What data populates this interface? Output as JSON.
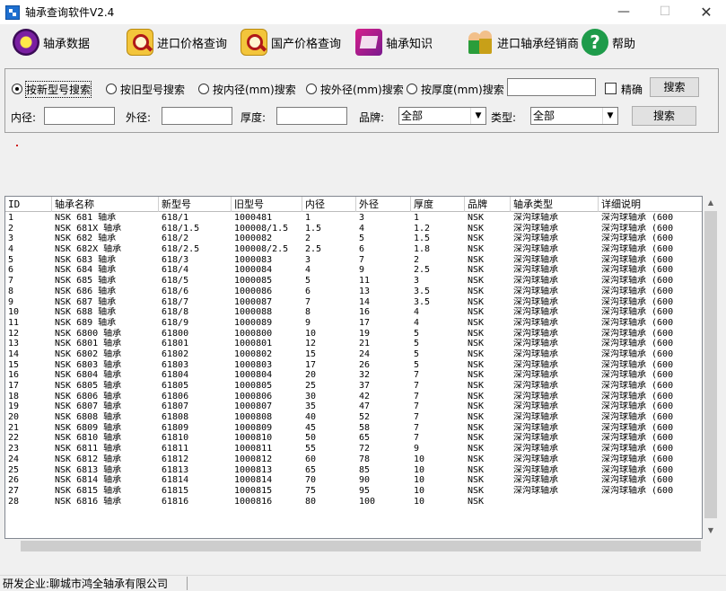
{
  "window": {
    "title": "轴承查询软件V2.4",
    "controls": {
      "minimize": "—",
      "maximize": "☐",
      "close": "✕"
    }
  },
  "toolbar": [
    {
      "label": "轴承数据",
      "icon": "disc-icon"
    },
    {
      "label": "进口价格查询",
      "icon": "magnifier-icon"
    },
    {
      "label": "国产价格查询",
      "icon": "magnifier-icon"
    },
    {
      "label": "轴承知识",
      "icon": "book-icon"
    },
    {
      "label": "进口轴承经销商",
      "icon": "people-icon"
    },
    {
      "label": "帮助",
      "icon": "help-icon"
    }
  ],
  "search": {
    "modes": [
      {
        "label": "按新型号搜索",
        "selected": true
      },
      {
        "label": "按旧型号搜索",
        "selected": false
      },
      {
        "label": "按内径(mm)搜索",
        "selected": false
      },
      {
        "label": "按外径(mm)搜索",
        "selected": false
      },
      {
        "label": "按厚度(mm)搜索",
        "selected": false
      }
    ],
    "keyword_value": "",
    "exact_label": "精确",
    "exact_checked": false,
    "search_button": "搜索",
    "inner_label": "内径:",
    "outer_label": "外径:",
    "thickness_label": "厚度:",
    "brand_label": "品牌:",
    "brand_value": "全部",
    "type_label": "类型:",
    "type_value": "全部",
    "search_button2": "搜索"
  },
  "table": {
    "columns": [
      "ID",
      "轴承名称",
      "新型号",
      "旧型号",
      "内径",
      "外径",
      "厚度",
      "品牌",
      "轴承类型",
      "详细说明"
    ],
    "rows": [
      [
        "1",
        "NSK 681 轴承",
        "618/1",
        "1000481",
        "1",
        "3",
        "1",
        "NSK",
        "深沟球轴承",
        "深沟球轴承 (600"
      ],
      [
        "2",
        "NSK 681X 轴承",
        "618/1.5",
        "100008/1.5",
        "1.5",
        "4",
        "1.2",
        "NSK",
        "深沟球轴承",
        "深沟球轴承 (600"
      ],
      [
        "3",
        "NSK 682 轴承",
        "618/2",
        "1000082",
        "2",
        "5",
        "1.5",
        "NSK",
        "深沟球轴承",
        "深沟球轴承 (600"
      ],
      [
        "4",
        "NSK 682X 轴承",
        "618/2.5",
        "100008/2.5",
        "2.5",
        "6",
        "1.8",
        "NSK",
        "深沟球轴承",
        "深沟球轴承 (600"
      ],
      [
        "5",
        "NSK 683 轴承",
        "618/3",
        "1000083",
        "3",
        "7",
        "2",
        "NSK",
        "深沟球轴承",
        "深沟球轴承 (600"
      ],
      [
        "6",
        "NSK 684 轴承",
        "618/4",
        "1000084",
        "4",
        "9",
        "2.5",
        "NSK",
        "深沟球轴承",
        "深沟球轴承 (600"
      ],
      [
        "7",
        "NSK 685 轴承",
        "618/5",
        "1000085",
        "5",
        "11",
        "3",
        "NSK",
        "深沟球轴承",
        "深沟球轴承 (600"
      ],
      [
        "8",
        "NSK 686 轴承",
        "618/6",
        "1000086",
        "6",
        "13",
        "3.5",
        "NSK",
        "深沟球轴承",
        "深沟球轴承 (600"
      ],
      [
        "9",
        "NSK 687 轴承",
        "618/7",
        "1000087",
        "7",
        "14",
        "3.5",
        "NSK",
        "深沟球轴承",
        "深沟球轴承 (600"
      ],
      [
        "10",
        "NSK 688 轴承",
        "618/8",
        "1000088",
        "8",
        "16",
        "4",
        "NSK",
        "深沟球轴承",
        "深沟球轴承 (600"
      ],
      [
        "11",
        "NSK 689 轴承",
        "618/9",
        "1000089",
        "9",
        "17",
        "4",
        "NSK",
        "深沟球轴承",
        "深沟球轴承 (600"
      ],
      [
        "12",
        "NSK 6800 轴承",
        "61800",
        "1000800",
        "10",
        "19",
        "5",
        "NSK",
        "深沟球轴承",
        "深沟球轴承 (600"
      ],
      [
        "13",
        "NSK 6801 轴承",
        "61801",
        "1000801",
        "12",
        "21",
        "5",
        "NSK",
        "深沟球轴承",
        "深沟球轴承 (600"
      ],
      [
        "14",
        "NSK 6802 轴承",
        "61802",
        "1000802",
        "15",
        "24",
        "5",
        "NSK",
        "深沟球轴承",
        "深沟球轴承 (600"
      ],
      [
        "15",
        "NSK 6803 轴承",
        "61803",
        "1000803",
        "17",
        "26",
        "5",
        "NSK",
        "深沟球轴承",
        "深沟球轴承 (600"
      ],
      [
        "16",
        "NSK 6804 轴承",
        "61804",
        "1000804",
        "20",
        "32",
        "7",
        "NSK",
        "深沟球轴承",
        "深沟球轴承 (600"
      ],
      [
        "17",
        "NSK 6805 轴承",
        "61805",
        "1000805",
        "25",
        "37",
        "7",
        "NSK",
        "深沟球轴承",
        "深沟球轴承 (600"
      ],
      [
        "18",
        "NSK 6806 轴承",
        "61806",
        "1000806",
        "30",
        "42",
        "7",
        "NSK",
        "深沟球轴承",
        "深沟球轴承 (600"
      ],
      [
        "19",
        "NSK 6807 轴承",
        "61807",
        "1000807",
        "35",
        "47",
        "7",
        "NSK",
        "深沟球轴承",
        "深沟球轴承 (600"
      ],
      [
        "20",
        "NSK 6808 轴承",
        "61808",
        "1000808",
        "40",
        "52",
        "7",
        "NSK",
        "深沟球轴承",
        "深沟球轴承 (600"
      ],
      [
        "21",
        "NSK 6809 轴承",
        "61809",
        "1000809",
        "45",
        "58",
        "7",
        "NSK",
        "深沟球轴承",
        "深沟球轴承 (600"
      ],
      [
        "22",
        "NSK 6810 轴承",
        "61810",
        "1000810",
        "50",
        "65",
        "7",
        "NSK",
        "深沟球轴承",
        "深沟球轴承 (600"
      ],
      [
        "23",
        "NSK 6811 轴承",
        "61811",
        "1000811",
        "55",
        "72",
        "9",
        "NSK",
        "深沟球轴承",
        "深沟球轴承 (600"
      ],
      [
        "24",
        "NSK 6812 轴承",
        "61812",
        "1000812",
        "60",
        "78",
        "10",
        "NSK",
        "深沟球轴承",
        "深沟球轴承 (600"
      ],
      [
        "25",
        "NSK 6813 轴承",
        "61813",
        "1000813",
        "65",
        "85",
        "10",
        "NSK",
        "深沟球轴承",
        "深沟球轴承 (600"
      ],
      [
        "26",
        "NSK 6814 轴承",
        "61814",
        "1000814",
        "70",
        "90",
        "10",
        "NSK",
        "深沟球轴承",
        "深沟球轴承 (600"
      ],
      [
        "27",
        "NSK 6815 轴承",
        "61815",
        "1000815",
        "75",
        "95",
        "10",
        "NSK",
        "深沟球轴承",
        "深沟球轴承 (600"
      ],
      [
        "28",
        "NSK 6816 轴承",
        "61816",
        "1000816",
        "80",
        "100",
        "10",
        "NSK",
        "",
        ""
      ]
    ]
  },
  "scroll": {
    "up": "▲",
    "down": "▼",
    "left": "◀",
    "right": "▶"
  },
  "status": {
    "company": "研发企业:聊城市鸿全轴承有限公司"
  }
}
